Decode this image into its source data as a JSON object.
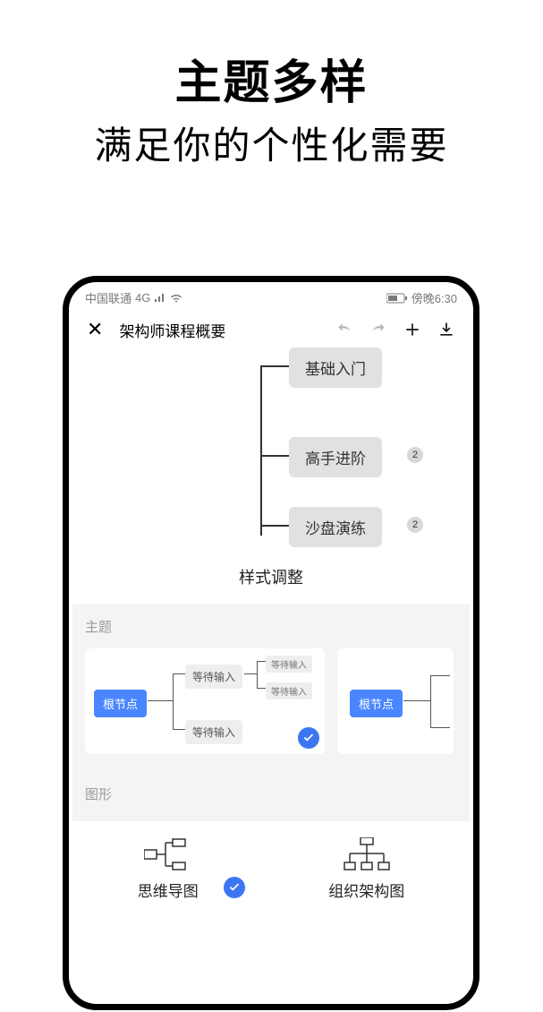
{
  "headline": "主题多样",
  "subhead": "满足你的个性化需要",
  "status": {
    "carrier": "中国联通",
    "signal": "4G",
    "time": "傍晚6:30"
  },
  "toolbar": {
    "doc_title": "架构师课程概要"
  },
  "mindmap": {
    "nodes": {
      "n0": "基础入门",
      "n1": "高手进阶",
      "n2": "沙盘演练"
    },
    "badge": "2"
  },
  "panel": {
    "title": "样式调整",
    "section_theme": "主题",
    "section_shape": "图形",
    "theme_root": "根节点",
    "theme_wait": "等待输入",
    "shapes": {
      "mindmap": "思维导图",
      "org": "组织架构图"
    }
  }
}
